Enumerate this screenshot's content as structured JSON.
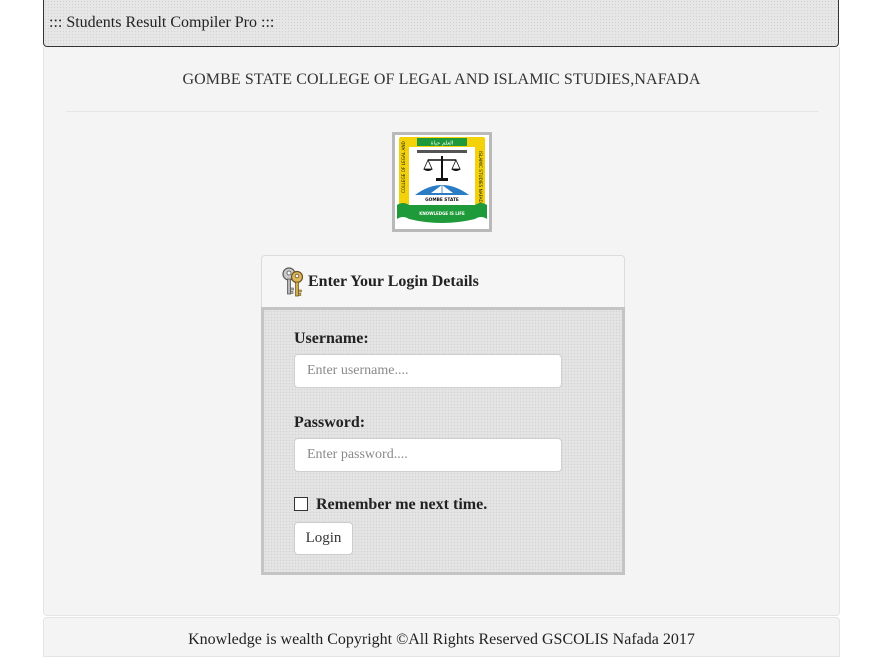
{
  "app": {
    "title": "::: Students Result Compiler Pro :::"
  },
  "header": {
    "institution": "GOMBE STATE COLLEGE OF LEGAL AND ISLAMIC STUDIES,NAFADA"
  },
  "logo": {
    "icon": "college-crest-logo",
    "text_arabic_top": "العلم حياة",
    "text_left": "COLLEGE OF LEGAL AND",
    "text_right": "ISLAMIC STUDIES NAFADA",
    "text_state": "GOMBE STATE",
    "text_motto": "KNOWLEDGE IS LIFE"
  },
  "login": {
    "heading": "Enter Your Login Details",
    "icon": "keys-icon",
    "username_label": "Username:",
    "username_placeholder": "Enter username....",
    "username_value": "",
    "password_label": "Password:",
    "password_placeholder": "Enter password....",
    "password_value": "",
    "remember_label": "Remember me next time.",
    "remember_checked": false,
    "submit_label": "Login"
  },
  "footer": {
    "text": "Knowledge is wealth Copyright ©All Rights Reserved GSCOLIS Nafada 2017"
  },
  "colors": {
    "logo_green": "#1f9a3a",
    "logo_yellow": "#f4d20a",
    "logo_blue": "#2a7dc4"
  }
}
